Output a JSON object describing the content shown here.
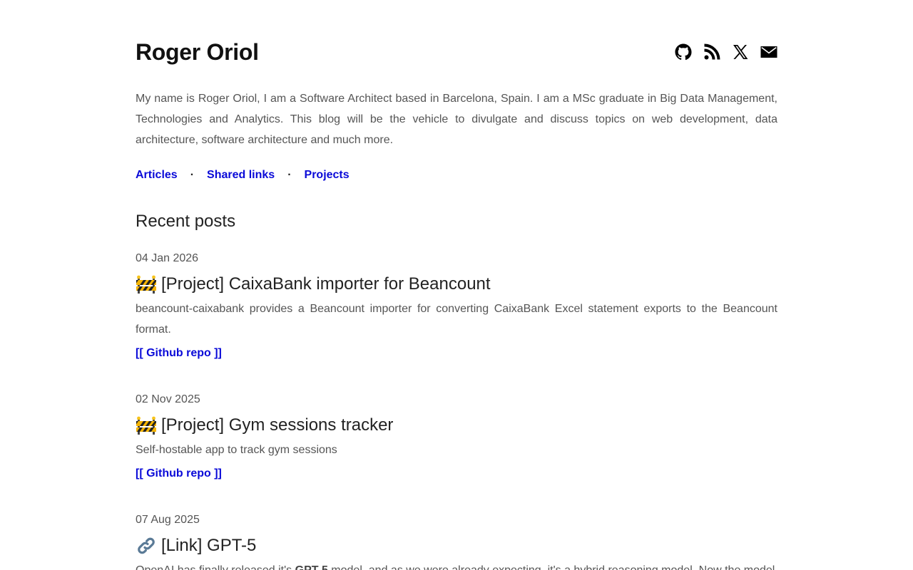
{
  "site": {
    "title": "Roger Oriol",
    "intro": "My name is Roger Oriol, I am a Software Architect based in Barcelona, Spain. I am a MSc graduate in Big Data Management, Technologies and Analytics. This blog will be the vehicle to divulgate and discuss topics on web development, data architecture, software architecture and much more."
  },
  "social": [
    {
      "icon": "github-icon"
    },
    {
      "icon": "rss-icon"
    },
    {
      "icon": "x-icon"
    },
    {
      "icon": "mail-icon"
    }
  ],
  "nav": {
    "items": [
      "Articles",
      "Shared links",
      "Projects"
    ],
    "separator": "·"
  },
  "recent": {
    "title": "Recent posts",
    "posts": [
      {
        "date": "04 Jan 2026",
        "icon": "construction-barrier-icon",
        "title": "[Project] CaixaBank importer for Beancount",
        "description": "beancount-caixabank provides a Beancount importer for converting CaixaBank Excel statement exports to the Beancount format.",
        "link": "[[ Github repo ]]"
      },
      {
        "date": "02 Nov 2025",
        "icon": "construction-barrier-icon",
        "title": "[Project] Gym sessions tracker",
        "description": "Self-hostable app to track gym sessions",
        "link": "[[ Github repo ]]"
      },
      {
        "date": "07 Aug 2025",
        "icon": "link-icon",
        "title": "[Link] GPT-5",
        "description_before": "OpenAI has finally released it's ",
        "description_bold": "GPT-5",
        "description_after": " model, and as we were already expecting, it's a hybrid reasoning model. Now the model"
      }
    ]
  }
}
